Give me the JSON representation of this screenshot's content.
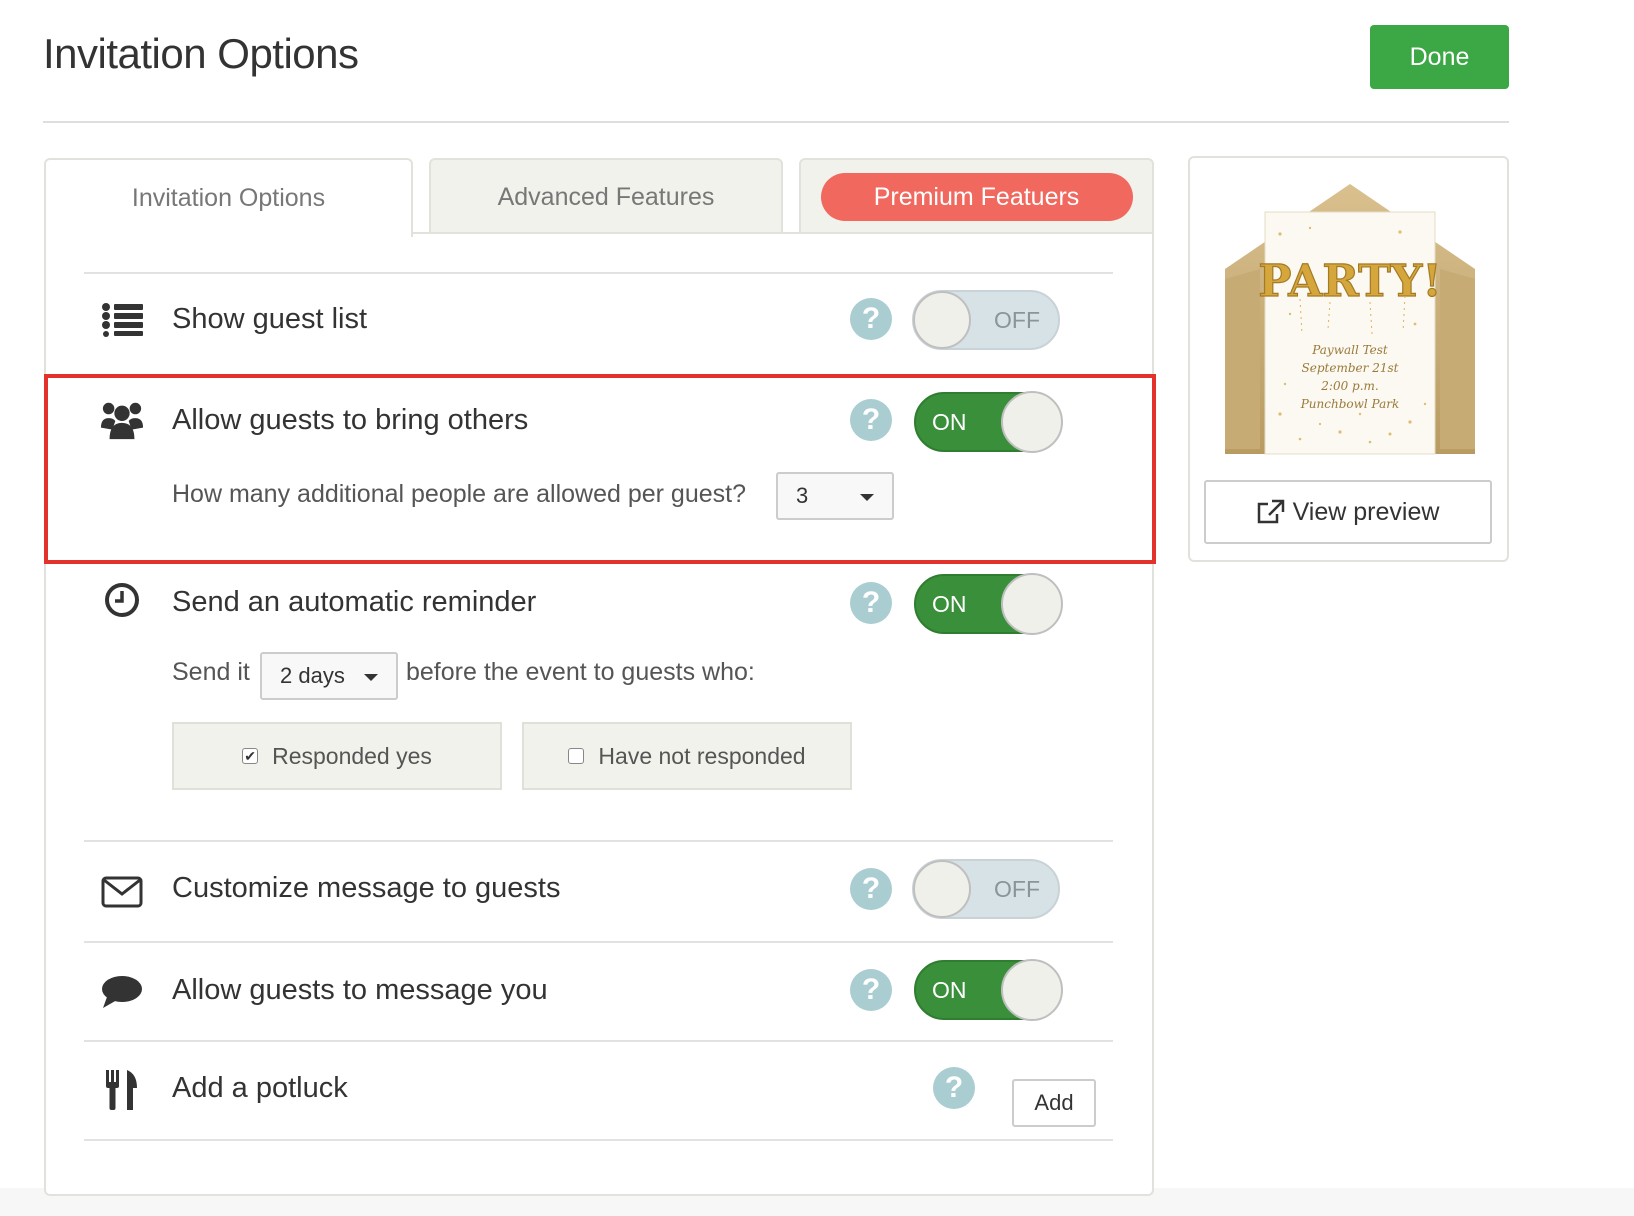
{
  "header": {
    "title": "Invitation Options",
    "done_label": "Done"
  },
  "tabs": [
    {
      "label": "Invitation Options",
      "active": true
    },
    {
      "label": "Advanced Features",
      "active": false
    },
    {
      "label": "Premium Featuers",
      "active": false
    }
  ],
  "options": {
    "guest_list": {
      "label": "Show guest list",
      "toggle": "OFF",
      "icon": "list-icon"
    },
    "bring_others": {
      "label": "Allow guests to bring others",
      "toggle": "ON",
      "icon": "group-icon",
      "question": "How many additional people are allowed per guest?",
      "count": "3"
    },
    "reminder": {
      "label": "Send an automatic reminder",
      "toggle": "ON",
      "icon": "clock-icon",
      "send_prefix": "Send it",
      "days": "2 days",
      "send_suffix": "before the event to guests who:",
      "responded_yes": "Responded yes",
      "responded_yes_checked": true,
      "not_responded": "Have not responded",
      "not_responded_checked": false
    },
    "custom_message": {
      "label": "Customize message to guests",
      "toggle": "OFF",
      "icon": "envelope-icon"
    },
    "message_you": {
      "label": "Allow guests to message you",
      "toggle": "ON",
      "icon": "speech-bubble-icon"
    },
    "potluck": {
      "label": "Add a potluck",
      "add_label": "Add",
      "icon": "fork-knife-icon"
    }
  },
  "help_symbol": "?",
  "preview": {
    "card_headline": "PARTY!",
    "card_lines": [
      "Paywall Test",
      "September 21st",
      "2:00 p.m.",
      "Punchbowl Park"
    ],
    "view_label": "View preview"
  },
  "colors": {
    "done_green": "#3ba745",
    "premium_red": "#f0685e",
    "toggle_on_green": "#3a8f3a",
    "highlight_red": "#e3312b",
    "help_blue": "#a9cdd1"
  }
}
